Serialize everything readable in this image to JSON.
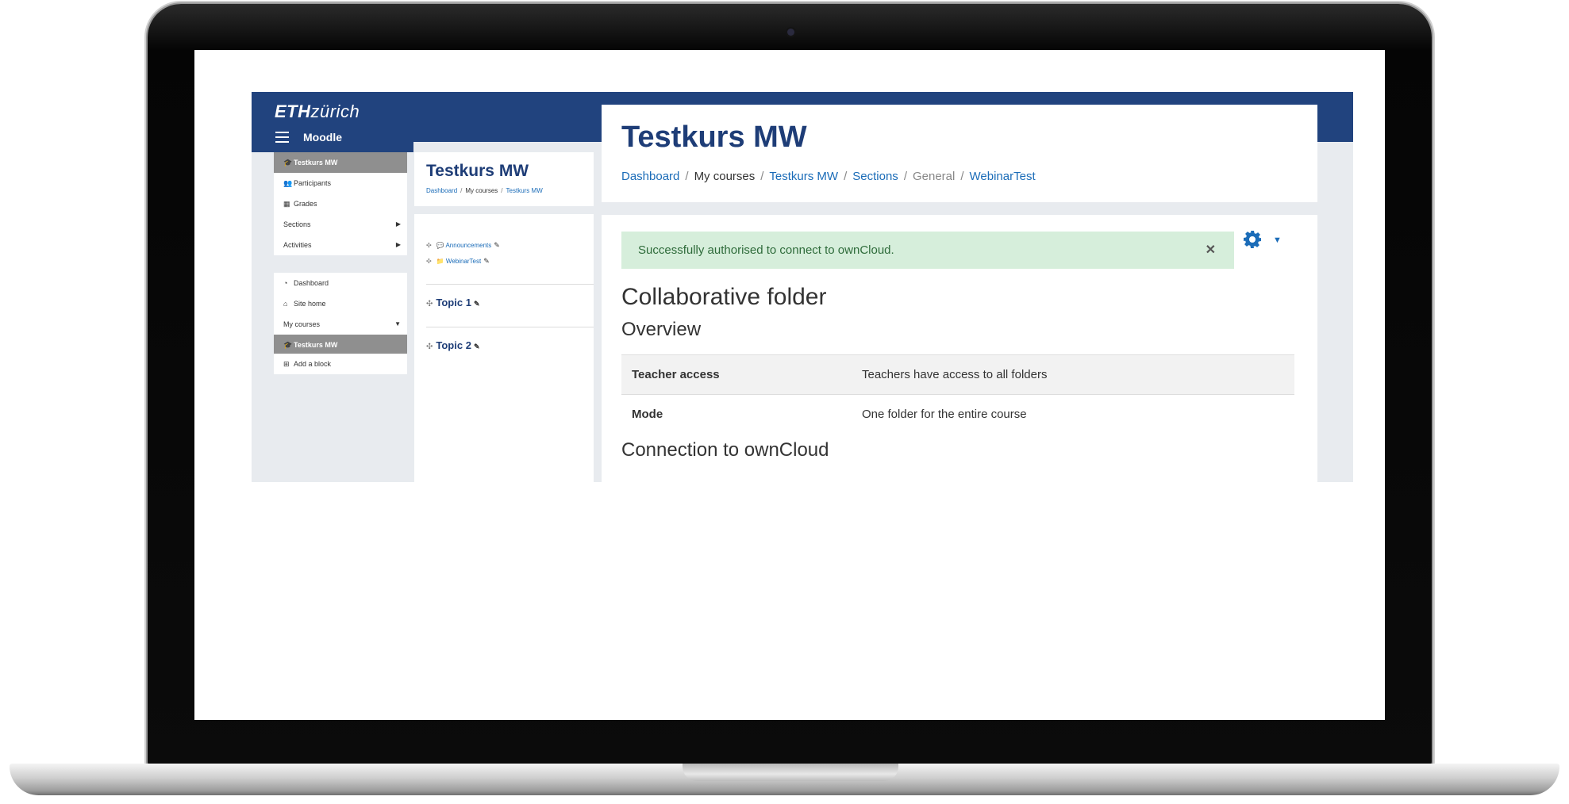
{
  "brand": {
    "eth_bold": "ETH",
    "eth_italic": "zürich",
    "app_name": "Moodle"
  },
  "nav_block1": [
    {
      "icon": "graduation-cap-icon",
      "glyph": "🎓",
      "label": "Testkurs MW",
      "active": true
    },
    {
      "icon": "users-icon",
      "glyph": "👥",
      "label": "Participants"
    },
    {
      "icon": "table-icon",
      "glyph": "▦",
      "label": "Grades"
    },
    {
      "label": "Sections",
      "caret": "▶"
    },
    {
      "label": "Activities",
      "caret": "▶"
    }
  ],
  "nav_block2": [
    {
      "icon": "dashboard-icon",
      "glyph": "◔",
      "label": "Dashboard"
    },
    {
      "icon": "home-icon",
      "glyph": "⌂",
      "label": "Site home"
    },
    {
      "label": "My courses",
      "caret": "▼"
    },
    {
      "icon": "graduation-cap-icon",
      "glyph": "🎓",
      "label": "Testkurs MW",
      "active": true
    }
  ],
  "add_block": {
    "glyph": "⊞",
    "label": "Add a block"
  },
  "mini": {
    "title": "Testkurs MW",
    "breadcrumb": [
      "Dashboard",
      "My courses",
      "Testkurs MW"
    ],
    "activities": [
      {
        "label": "Announcements",
        "glyph": "💬"
      },
      {
        "label": "WebinarTest",
        "glyph": "📁"
      }
    ],
    "topics": [
      "Topic 1",
      "Topic 2"
    ]
  },
  "main": {
    "title": "Testkurs MW",
    "breadcrumb": [
      {
        "label": "Dashboard",
        "style": "link"
      },
      {
        "label": "My courses",
        "style": "plain"
      },
      {
        "label": "Testkurs MW",
        "style": "link"
      },
      {
        "label": "Sections",
        "style": "link"
      },
      {
        "label": "General",
        "style": "muted"
      },
      {
        "label": "WebinarTest",
        "style": "link"
      }
    ],
    "alert": "Successfully authorised to connect to ownCloud.",
    "close_glyph": "✕",
    "heading": "Collaborative folder",
    "overview": "Overview",
    "table": [
      {
        "key": "Teacher access",
        "value": "Teachers have access to all folders"
      },
      {
        "key": "Mode",
        "value": "One folder for the entire course"
      }
    ],
    "connection_heading": "Connection to ownCloud"
  }
}
